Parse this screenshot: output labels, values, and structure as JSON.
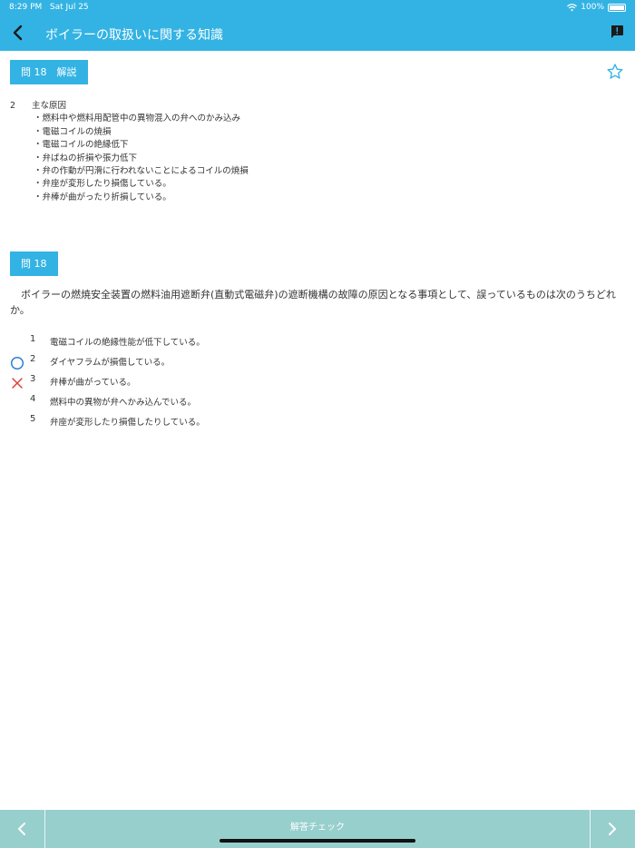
{
  "status": {
    "time": "8:29 PM",
    "date": "Sat Jul 25",
    "battery": "100%"
  },
  "nav": {
    "title": "ボイラーの取扱いに関する知識"
  },
  "explanation": {
    "tag": "問 18　解説",
    "answer": "2",
    "heading": "主な原因",
    "items": [
      "・燃料中や燃料用配管中の異物混入の弁へのかみ込み",
      "・電磁コイルの焼損",
      "・電磁コイルの絶縁低下",
      "・弁ばねの折損や張力低下",
      "・弁の作動が円滑に行われないことによるコイルの焼損",
      "・弁座が変形したり損傷している。",
      "・弁棒が曲がったり折損している。"
    ]
  },
  "question": {
    "tag": "問 18",
    "text": "ボイラーの燃焼安全装置の燃料油用遮断弁(直動式電磁弁)の遮断機構の故障の原因となる事項として、誤っているものは次のうちどれか。"
  },
  "choices": [
    {
      "num": "1",
      "text": "電磁コイルの絶縁性能が低下している。",
      "mark": "none"
    },
    {
      "num": "2",
      "text": "ダイヤフラムが損傷している。",
      "mark": "correct"
    },
    {
      "num": "3",
      "text": "弁棒が曲がっている。",
      "mark": "wrong"
    },
    {
      "num": "4",
      "text": "燃料中の異物が弁へかみ込んでいる。",
      "mark": "none"
    },
    {
      "num": "5",
      "text": "弁座が変形したり損傷したりしている。",
      "mark": "none"
    }
  ],
  "bottom": {
    "check_label": "解答チェック"
  },
  "colors": {
    "accent": "#33b3e3",
    "bottom_bar": "#97cfcd",
    "correct": "#2a7fd4",
    "wrong": "#e0413a"
  },
  "icons": {
    "back": "chevron-left-icon",
    "report": "report-icon",
    "star": "star-outline-icon",
    "prev": "chevron-left-icon",
    "next": "chevron-right-icon"
  }
}
